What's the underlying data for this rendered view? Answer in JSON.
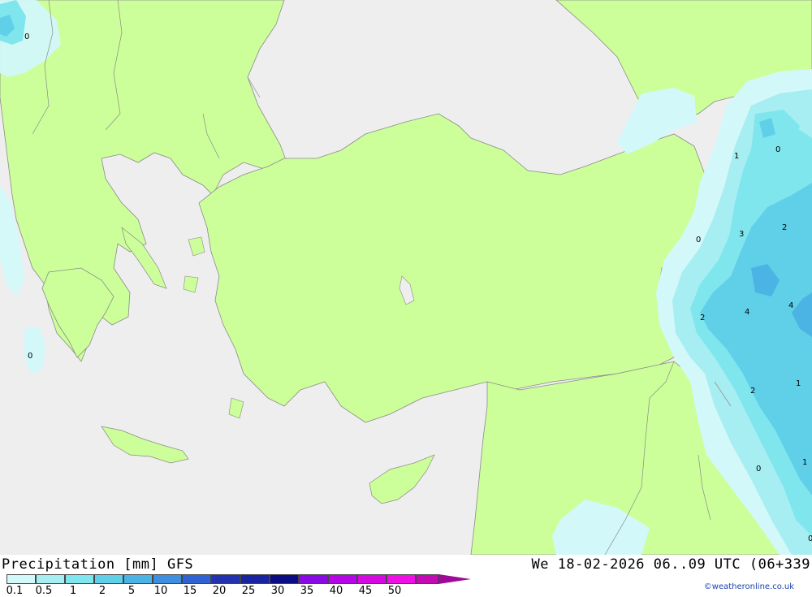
{
  "map": {
    "colors": {
      "land": "#ccff99",
      "sea": "#eeeeee",
      "border": "#8a8a8a",
      "precip_0_1": "#d2f8fa",
      "precip_0_5": "#a6eef2",
      "precip_1": "#80e6ee",
      "precip_2": "#5fd0e8"
    },
    "contour_labels": [
      {
        "id": "nw-0",
        "text": "0"
      },
      {
        "id": "ionian-0",
        "text": "0"
      },
      {
        "id": "e-1",
        "text": "1"
      },
      {
        "id": "e-0",
        "text": "0"
      },
      {
        "id": "e-2a",
        "text": "2"
      },
      {
        "id": "e-0b",
        "text": "0"
      },
      {
        "id": "e-3",
        "text": "3"
      },
      {
        "id": "e-2b",
        "text": "2"
      },
      {
        "id": "e-4a",
        "text": "4"
      },
      {
        "id": "e-4b",
        "text": "4"
      },
      {
        "id": "e-2c",
        "text": "2"
      },
      {
        "id": "e-1b",
        "text": "1"
      },
      {
        "id": "e-0c",
        "text": "0"
      },
      {
        "id": "e-1c",
        "text": "1"
      },
      {
        "id": "e-0d",
        "text": "0"
      }
    ]
  },
  "footer": {
    "title": "Precipitation [mm] GFS",
    "datetime": "We 18-02-2026 06..09 UTC (06+339",
    "credit": "©weatheronline.co.uk"
  },
  "legend": {
    "colors": [
      "#d2f8fa",
      "#a6eef2",
      "#80e6ee",
      "#5fd0e8",
      "#4cb4e4",
      "#3e8fe0",
      "#2f62d2",
      "#2333b0",
      "#1a24a0",
      "#0c0c84",
      "#8a0ae6",
      "#b406e6",
      "#d50ae0",
      "#f010e6",
      "#c40ab4",
      "#9c0a96"
    ],
    "labels": [
      "0.1",
      "0.5",
      "1",
      "2",
      "5",
      "10",
      "15",
      "20",
      "25",
      "30",
      "35",
      "40",
      "45",
      "50"
    ]
  }
}
